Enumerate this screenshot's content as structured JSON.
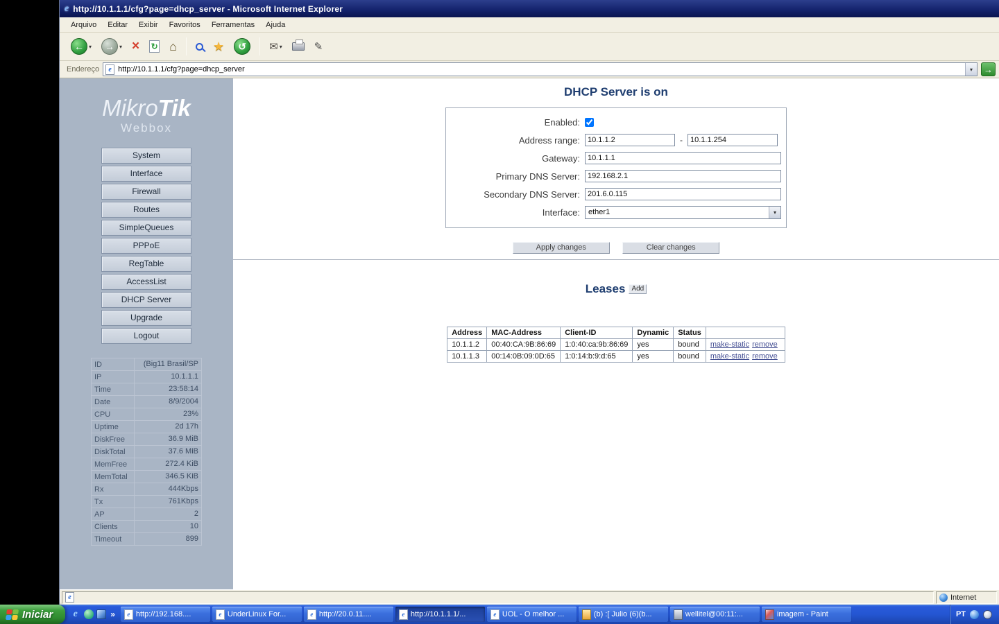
{
  "window": {
    "title": "http://10.1.1.1/cfg?page=dhcp_server - Microsoft Internet Explorer"
  },
  "menubar": {
    "items": [
      "Arquivo",
      "Editar",
      "Exibir",
      "Favoritos",
      "Ferramentas",
      "Ajuda"
    ]
  },
  "addressbar": {
    "label": "Endereço",
    "url": "http://10.1.1.1/cfg?page=dhcp_server"
  },
  "icons": {
    "back_arrow": "←",
    "forward_arrow": "→",
    "stop_x": "×",
    "refresh": "↻",
    "home": "⌂",
    "favorites_star": "★",
    "history": "↺",
    "mail": "✉",
    "edit": "✎",
    "dropdown": "▾",
    "go_arrow": "→",
    "ie_e": "e",
    "overflow": "»"
  },
  "sidebar": {
    "logo_part1": "Mikro",
    "logo_part2": "Tik",
    "subtitle": "Webbox",
    "nav": [
      "System",
      "Interface",
      "Firewall",
      "Routes",
      "SimpleQueues",
      "PPPoE",
      "RegTable",
      "AccessList",
      "DHCP Server",
      "Upgrade",
      "Logout"
    ],
    "stats": [
      {
        "label": "ID",
        "value": "(Big11 Brasil/SP"
      },
      {
        "label": "IP",
        "value": "10.1.1.1"
      },
      {
        "label": "Time",
        "value": "23:58:14"
      },
      {
        "label": "Date",
        "value": "8/9/2004"
      },
      {
        "label": "CPU",
        "value": "23%"
      },
      {
        "label": "Uptime",
        "value": "2d 17h"
      },
      {
        "label": "DiskFree",
        "value": "36.9 MiB"
      },
      {
        "label": "DiskTotal",
        "value": "37.6 MiB"
      },
      {
        "label": "MemFree",
        "value": "272.4 KiB"
      },
      {
        "label": "MemTotal",
        "value": "346.5 KiB"
      },
      {
        "label": "Rx",
        "value": "444Kbps"
      },
      {
        "label": "Tx",
        "value": "761Kbps"
      },
      {
        "label": "AP",
        "value": "2"
      },
      {
        "label": "Clients",
        "value": "10"
      },
      {
        "label": "Timeout",
        "value": "899"
      }
    ]
  },
  "main": {
    "title": "DHCP Server is on",
    "form": {
      "enabled_label": "Enabled:",
      "enabled_checked": true,
      "address_range_label": "Address range:",
      "address_range_start": "10.1.1.2",
      "address_range_end": "10.1.1.254",
      "range_separator": "-",
      "gateway_label": "Gateway:",
      "gateway": "10.1.1.1",
      "primary_dns_label": "Primary DNS Server:",
      "primary_dns": "192.168.2.1",
      "secondary_dns_label": "Secondary DNS Server:",
      "secondary_dns": "201.6.0.115",
      "interface_label": "Interface:",
      "interface": "ether1",
      "apply_label": "Apply changes",
      "clear_label": "Clear changes"
    },
    "leases": {
      "title": "Leases",
      "add_label": "Add",
      "headers": [
        "Address",
        "MAC-Address",
        "Client-ID",
        "Dynamic",
        "Status"
      ],
      "rows": [
        {
          "address": "10.1.1.2",
          "mac": "00:40:CA:9B:86:69",
          "client_id": "1:0:40:ca:9b:86:69",
          "dynamic": "yes",
          "status": "bound",
          "make_static": "make-static",
          "remove": "remove"
        },
        {
          "address": "10.1.1.3",
          "mac": "00:14:0B:09:0D:65",
          "client_id": "1:0:14:b:9:d:65",
          "dynamic": "yes",
          "status": "bound",
          "make_static": "make-static",
          "remove": "remove"
        }
      ]
    }
  },
  "statusbar": {
    "zone": "Internet"
  },
  "taskbar": {
    "start_label": "Iniciar",
    "tasks": [
      {
        "label": "http://192.168....",
        "active": false
      },
      {
        "label": "UnderLinux For...",
        "active": false
      },
      {
        "label": "http://20.0.11....",
        "active": false
      },
      {
        "label": "http://10.1.1.1/...",
        "active": true
      },
      {
        "label": "UOL - O melhor ...",
        "active": false
      },
      {
        "label": "(b) :[ Julio (6)(b...",
        "active": false
      },
      {
        "label": "wellitel@00:11:...",
        "active": false
      },
      {
        "label": "imagem - Paint",
        "active": false
      }
    ],
    "tray_lang": "PT"
  }
}
